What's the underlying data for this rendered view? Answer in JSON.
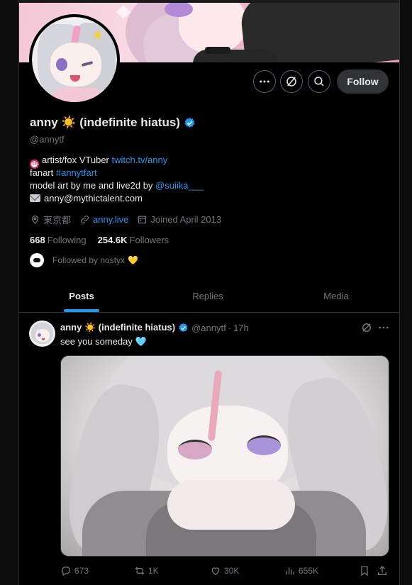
{
  "profile": {
    "display_name": "anny ☀️ (indefinite hiatus)",
    "handle": "@annytf",
    "follow_label": "Follow",
    "bio": {
      "line1_prefix": "artist/fox VTuber ",
      "line1_link": "twitch.tv/anny",
      "line2_prefix": "fanart ",
      "line2_link": "#annytfart",
      "line3_prefix": "model art by me and live2d by ",
      "line3_link": "@suiika___",
      "line4": "anny@mythictalent.com",
      "age_badge": "18"
    },
    "location": "東京都",
    "website": "anny.live",
    "joined": "Joined April 2013",
    "following_count": "668",
    "following_label": "Following",
    "followers_count": "254.6K",
    "followers_label": "Followers",
    "followed_by": "Followed by nostyx",
    "followed_by_emoji": "💛"
  },
  "tabs": [
    {
      "label": "Posts",
      "active": true
    },
    {
      "label": "Replies",
      "active": false
    },
    {
      "label": "Media",
      "active": false
    }
  ],
  "post": {
    "author": "anny ☀️ (indefinite hiatus)",
    "handle": "@annytf",
    "separator": "·",
    "time": "17h",
    "text": "see you someday",
    "text_emoji": "🩵",
    "replies": "673",
    "reposts": "1K",
    "likes": "30K",
    "views": "655K"
  },
  "colors": {
    "accent": "#1d9bf0",
    "background": "#000000",
    "muted_text": "#71767b",
    "border": "#2f3336"
  },
  "icons": [
    "more-icon",
    "grok-icon",
    "search-icon",
    "verified-badge-icon",
    "location-icon",
    "link-icon",
    "calendar-icon",
    "reply-icon",
    "repost-icon",
    "like-icon",
    "views-icon",
    "bookmark-icon",
    "share-icon"
  ]
}
